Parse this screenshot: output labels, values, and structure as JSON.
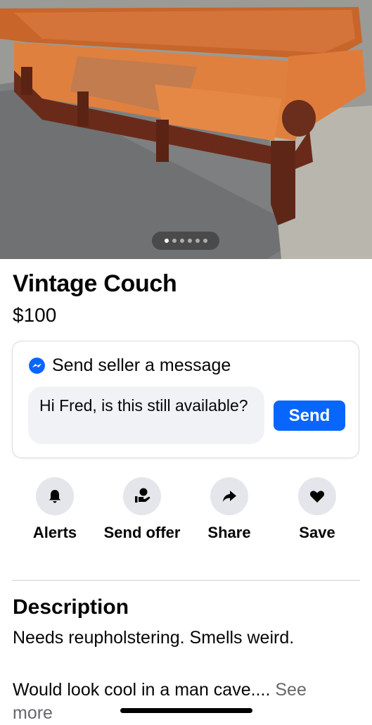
{
  "listing": {
    "title": "Vintage Couch",
    "price": "$100",
    "photo_count": 6,
    "active_photo_index": 0
  },
  "message": {
    "heading": "Send seller a message",
    "input_value": "Hi Fred, is this still available?",
    "send_label": "Send"
  },
  "actions": [
    {
      "label": "Alerts",
      "icon": "bell-icon"
    },
    {
      "label": "Send offer",
      "icon": "offer-icon"
    },
    {
      "label": "Share",
      "icon": "share-arrow-icon"
    },
    {
      "label": "Save",
      "icon": "heart-icon"
    }
  ],
  "description": {
    "heading": "Description",
    "line1": "Needs reupholstering.  Smells weird.",
    "line2": "Would look cool in a man cave....",
    "see_more": "See more"
  },
  "colors": {
    "accent": "#0866ff",
    "icon_bg": "#e4e6eb",
    "input_bg": "#f0f2f5",
    "secondary_text": "#65676b"
  }
}
